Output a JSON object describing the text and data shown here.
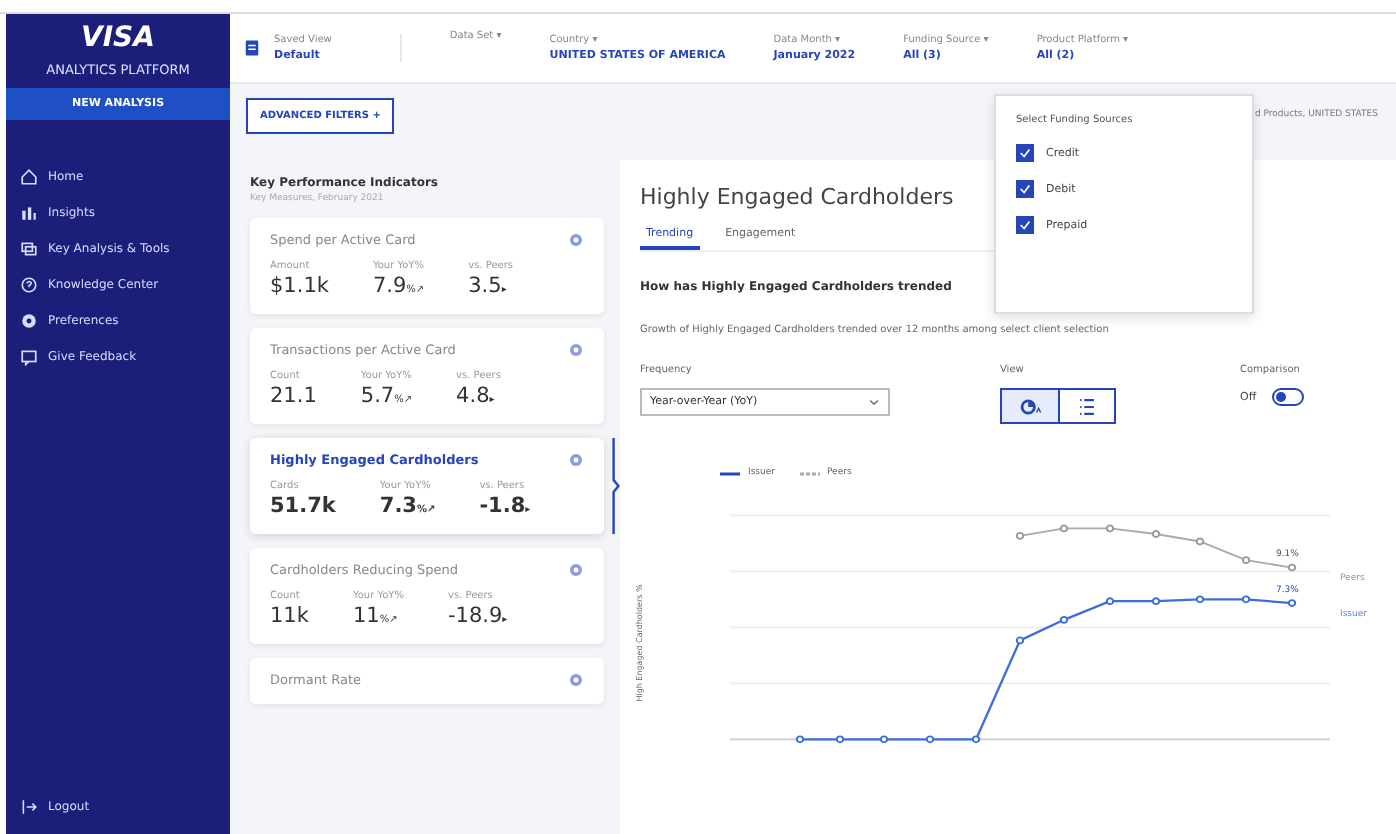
{
  "sidebar": {
    "logo": "VISA",
    "product": "ANALYTICS PLATFORM",
    "new_button": "NEW ANALYSIS",
    "items": [
      {
        "label": "Home"
      },
      {
        "label": "Insights"
      },
      {
        "label": "Key Analysis & Tools"
      },
      {
        "label": "Knowledge Center"
      },
      {
        "label": "Preferences"
      },
      {
        "label": "Give Feedback"
      }
    ],
    "logout": "Logout"
  },
  "filter_bar": {
    "saved_view": {
      "label": "Saved View",
      "value": "Default"
    },
    "filters": [
      {
        "label": "Data Set ▾"
      },
      {
        "label": "Country ▾",
        "value": "UNITED STATES OF AMERICA"
      },
      {
        "label": "Data Month ▾",
        "value": "January 2022"
      },
      {
        "label": "Funding Source ▾",
        "value": "All (3)"
      },
      {
        "label": "Product Platform ▾",
        "value": "All (2)"
      }
    ],
    "advanced_button": "ADVANCED FILTERS +",
    "summary": "d Products, UNITED STATES"
  },
  "funding_dropdown": {
    "title": "Select Funding Sources",
    "options": [
      {
        "label": "Credit",
        "checked": true
      },
      {
        "label": "Debit",
        "checked": true
      },
      {
        "label": "Prepaid",
        "checked": true
      }
    ]
  },
  "kpi": {
    "title": "Key Performance Indicators",
    "subtitle": "Key Measures, February 2021",
    "cards": [
      {
        "title": "Spend per Active Card",
        "selected": false,
        "metrics": [
          {
            "label": "Amount",
            "value": "$1.1k"
          },
          {
            "label": "Your YoY%",
            "value": "7.9",
            "unit": "%↗"
          },
          {
            "label": "vs. Peers",
            "value": "3.5",
            "unit": "▸"
          }
        ]
      },
      {
        "title": "Transactions per Active Card",
        "selected": false,
        "metrics": [
          {
            "label": "Count",
            "value": "21.1"
          },
          {
            "label": "Your YoY%",
            "value": "5.7",
            "unit": "%↗"
          },
          {
            "label": "vs. Peers",
            "value": "4.8",
            "unit": "▸"
          }
        ]
      },
      {
        "title": "Highly Engaged Cardholders",
        "selected": true,
        "metrics": [
          {
            "label": "Cards",
            "value": "51.7k"
          },
          {
            "label": "Your YoY%",
            "value": "7.3",
            "unit": "%↗"
          },
          {
            "label": "vs. Peers",
            "value": "-1.8",
            "unit": "▸"
          }
        ]
      },
      {
        "title": "Cardholders Reducing Spend",
        "selected": false,
        "metrics": [
          {
            "label": "Count",
            "value": "11k"
          },
          {
            "label": "Your YoY%",
            "value": "11",
            "unit": "%↗"
          },
          {
            "label": "vs. Peers",
            "value": "-18.9",
            "unit": "▸"
          }
        ]
      },
      {
        "title": "Dormant Rate",
        "selected": false
      }
    ]
  },
  "detail": {
    "title": "Highly Engaged Cardholders",
    "tabs": [
      {
        "label": "Trending",
        "selected": true
      },
      {
        "label": "Engagement",
        "selected": false
      }
    ],
    "question": "How has Highly Engaged Cardholders trended",
    "description": "Growth of Highly Engaged Cardholders trended over 12 months among select client selection",
    "frequency": {
      "label": "Frequency",
      "value": "Year-over-Year (YoY)"
    },
    "view": {
      "label": "View",
      "options": [
        {
          "kind": "chart",
          "selected": true
        },
        {
          "kind": "list",
          "selected": false
        }
      ]
    },
    "comparison": {
      "label": "Comparison",
      "state": "Off",
      "on": false
    },
    "chart": {
      "legend": [
        "Issuer",
        "Peers"
      ],
      "y_title": "High Engaged Cardholders %",
      "end_labels": [
        "9.1%",
        "7.3%"
      ],
      "series_labels": [
        "Peers",
        "Issuer"
      ]
    }
  }
}
